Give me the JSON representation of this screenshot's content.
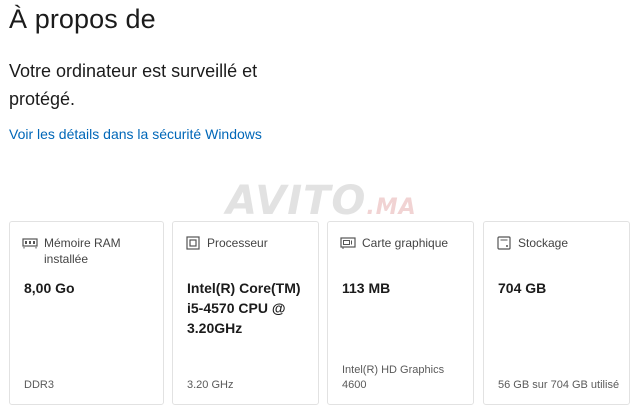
{
  "page": {
    "title": "À propos de",
    "subtitle": "Votre ordinateur est surveillé et protégé.",
    "link": "Voir les détails dans la sécurité Windows"
  },
  "watermark": {
    "main": "AVITO",
    "suffix": ".MA"
  },
  "cards": [
    {
      "icon": "memory-icon",
      "label": "Mémoire RAM installée",
      "value": "8,00 Go",
      "detail": "DDR3"
    },
    {
      "icon": "processor-icon",
      "label": "Processeur",
      "value": "Intel(R) Core(TM) i5-4570 CPU @ 3.20GHz",
      "detail": "3.20 GHz"
    },
    {
      "icon": "graphics-card-icon",
      "label": "Carte graphique",
      "value": "113 MB",
      "detail": "Intel(R) HD Graphics 4600"
    },
    {
      "icon": "storage-icon",
      "label": "Stockage",
      "value": "704 GB",
      "detail": "56 GB sur 704 GB utilisé"
    }
  ],
  "colors": {
    "link": "#0067b8",
    "text": "#1b1b1b",
    "card_border": "#e2e2e2"
  }
}
